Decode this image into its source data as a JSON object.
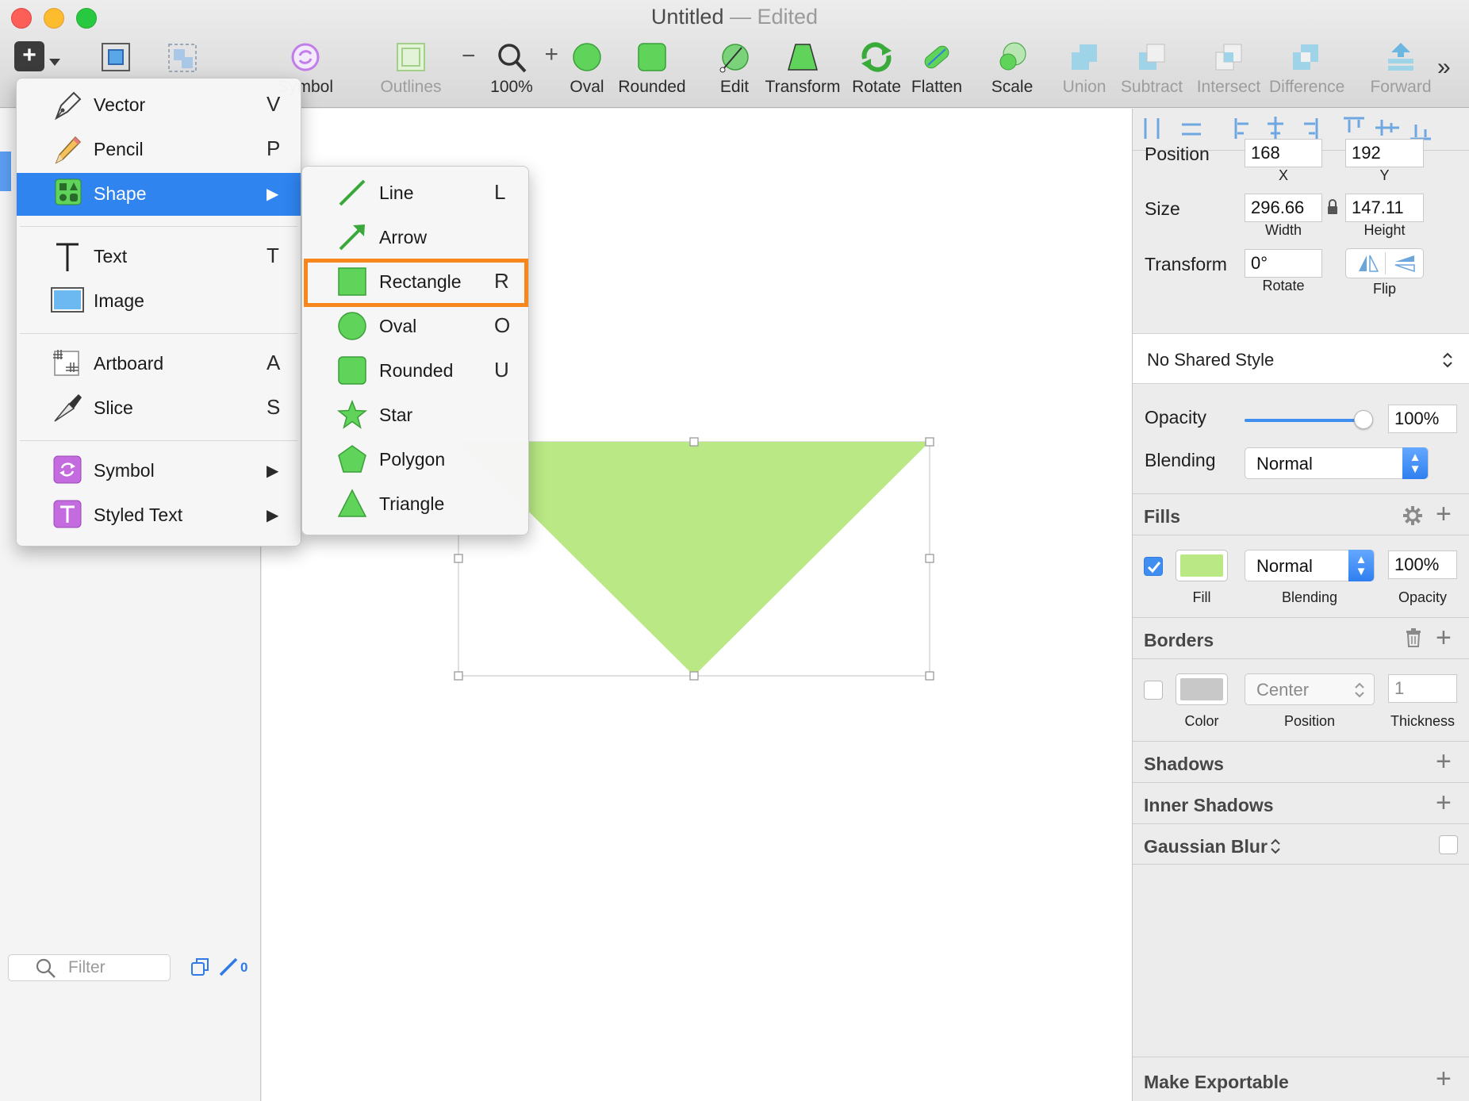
{
  "window": {
    "title": "Untitled",
    "title_sep": "—",
    "status": "Edited",
    "controls": [
      "close",
      "minimize",
      "maximize"
    ]
  },
  "toolbar": {
    "symbol_label": "Symbol",
    "outlines_label": "Outlines",
    "zoom_minus": "−",
    "zoom_plus": "+",
    "zoom_value": "100%",
    "oval_label": "Oval",
    "rounded_label": "Rounded",
    "edit_label": "Edit",
    "transform_label": "Transform",
    "rotate_label": "Rotate",
    "flatten_label": "Flatten",
    "scale_label": "Scale",
    "union_label": "Union",
    "subtract_label": "Subtract",
    "intersect_label": "Intersect",
    "difference_label": "Difference",
    "forward_label": "Forward",
    "overflow": "»"
  },
  "insert_menu": {
    "items": [
      {
        "label": "Vector",
        "shortcut": "V",
        "icon": "pen-icon"
      },
      {
        "label": "Pencil",
        "shortcut": "P",
        "icon": "pencil-icon"
      },
      {
        "label": "Shape",
        "shortcut": "▶",
        "icon": "shapes-icon",
        "highlighted": true
      },
      {
        "label": "Text",
        "shortcut": "T",
        "icon": "text-icon"
      },
      {
        "label": "Image",
        "shortcut": "",
        "icon": "image-icon"
      },
      {
        "label": "Artboard",
        "shortcut": "A",
        "icon": "artboard-icon"
      },
      {
        "label": "Slice",
        "shortcut": "S",
        "icon": "knife-icon"
      },
      {
        "label": "Symbol",
        "shortcut": "▶",
        "icon": "symbol-icon"
      },
      {
        "label": "Styled Text",
        "shortcut": "▶",
        "icon": "styled-text-icon"
      }
    ]
  },
  "shape_menu": {
    "items": [
      {
        "label": "Line",
        "shortcut": "L",
        "icon": "line-icon"
      },
      {
        "label": "Arrow",
        "shortcut": "",
        "icon": "arrow-icon"
      },
      {
        "label": "Rectangle",
        "shortcut": "R",
        "icon": "rectangle-icon",
        "highlighted": true
      },
      {
        "label": "Oval",
        "shortcut": "O",
        "icon": "oval-icon"
      },
      {
        "label": "Rounded",
        "shortcut": "U",
        "icon": "rounded-rect-icon"
      },
      {
        "label": "Star",
        "shortcut": "",
        "icon": "star-icon"
      },
      {
        "label": "Polygon",
        "shortcut": "",
        "icon": "polygon-icon"
      },
      {
        "label": "Triangle",
        "shortcut": "",
        "icon": "triangle-icon"
      }
    ]
  },
  "layers": {
    "filter_placeholder": "Filter",
    "count": "0"
  },
  "canvas": {
    "shape_fill": "#b9e884"
  },
  "inspector": {
    "position_label": "Position",
    "position_x": "168",
    "position_y": "192",
    "x_label": "X",
    "y_label": "Y",
    "size_label": "Size",
    "width": "296.66",
    "height": "147.11",
    "width_label": "Width",
    "height_label": "Height",
    "transform_label": "Transform",
    "rotate_value": "0°",
    "rotate_label": "Rotate",
    "flip_label": "Flip",
    "shared_style": "No Shared Style",
    "opacity_label": "Opacity",
    "opacity_value": "100%",
    "opacity_fraction": 1.0,
    "blending_label": "Blending",
    "blending_value": "Normal",
    "fills": {
      "title": "Fills",
      "enabled": true,
      "color": "#b9e884",
      "blending": "Normal",
      "opacity": "100%",
      "fill_label": "Fill",
      "blending_label": "Blending",
      "opacity_label": "Opacity"
    },
    "borders": {
      "title": "Borders",
      "enabled": false,
      "color": "#c8c8c8",
      "position": "Center",
      "thickness": "1",
      "color_label": "Color",
      "position_label": "Position",
      "thickness_label": "Thickness"
    },
    "shadows_title": "Shadows",
    "inner_shadows_title": "Inner Shadows",
    "gaussian_blur_title": "Gaussian Blur",
    "make_exportable": "Make Exportable"
  },
  "colors": {
    "accent": "#2f84f0",
    "highlight_border": "#f7861d",
    "green": "#5fd35a"
  }
}
